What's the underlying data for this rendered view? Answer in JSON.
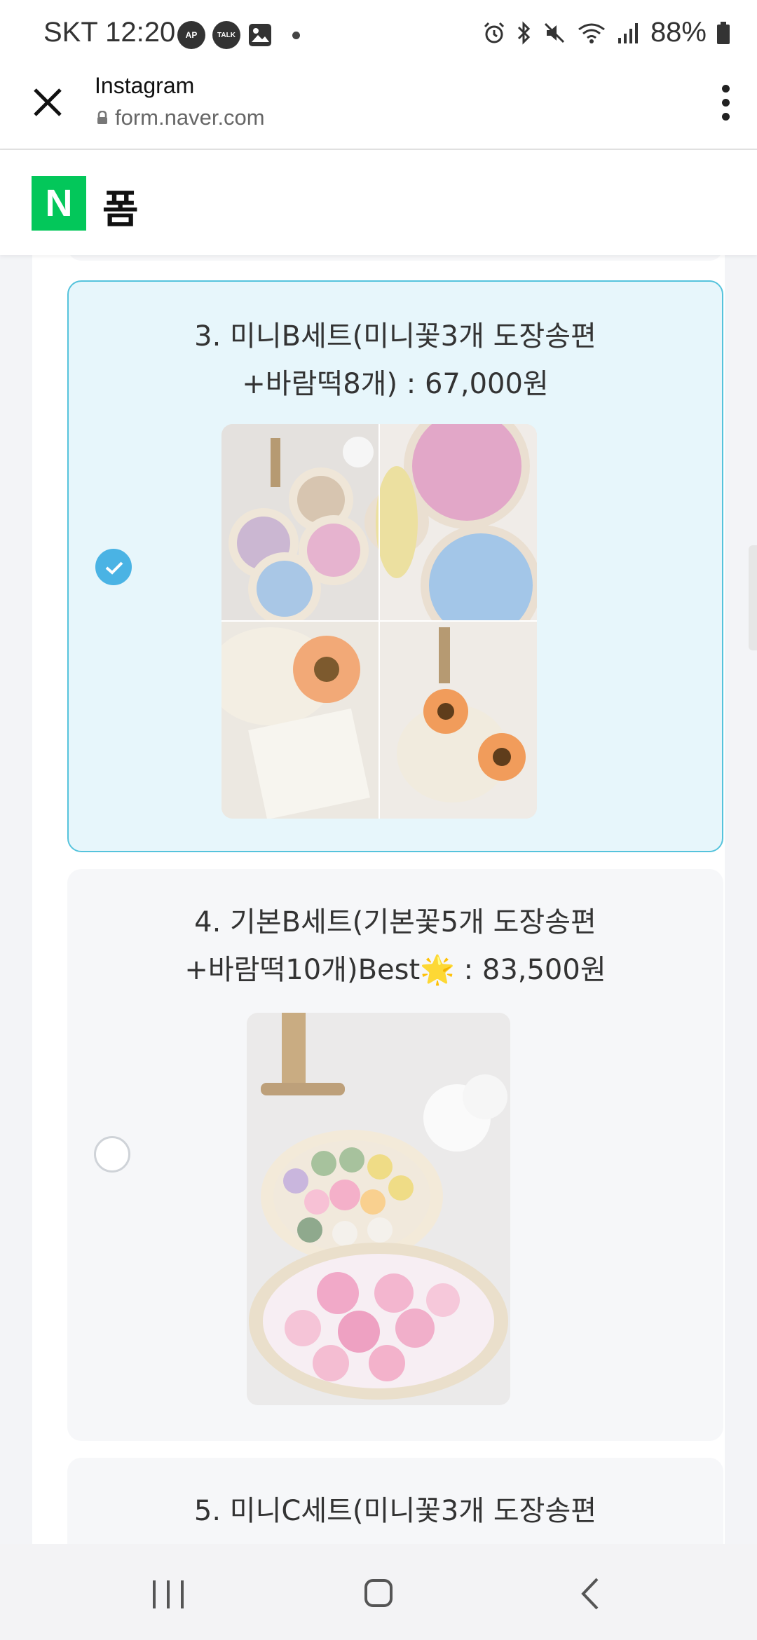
{
  "status_bar": {
    "time": "SKT 12:20",
    "notification_icons": [
      "AP",
      "TALK",
      "image-icon"
    ],
    "battery_text": "88%"
  },
  "browser": {
    "app_name": "Instagram",
    "url": "form.naver.com"
  },
  "form_header": {
    "logo": "N",
    "title": "폼"
  },
  "options": [
    {
      "number": "3",
      "line1": "3. 미니B세트(미니꽃3개 도장송편",
      "line2": "+바람떡8개) : 67,000원",
      "selected": true
    },
    {
      "number": "4",
      "line1": "4. 기본B세트(기본꽃5개 도장송편",
      "line2": "+바람떡10개)Best🌟 : 83,500원",
      "selected": false
    },
    {
      "number": "5",
      "line1": "5. 미니C세트(미니꽃3개 도장송편",
      "line2": "",
      "selected": false
    }
  ],
  "colors": {
    "selected_bg": "#e7f6fb",
    "selected_border": "#55c3dc",
    "radio_checked": "#4ab3e4",
    "naver_green": "#03c75a"
  }
}
